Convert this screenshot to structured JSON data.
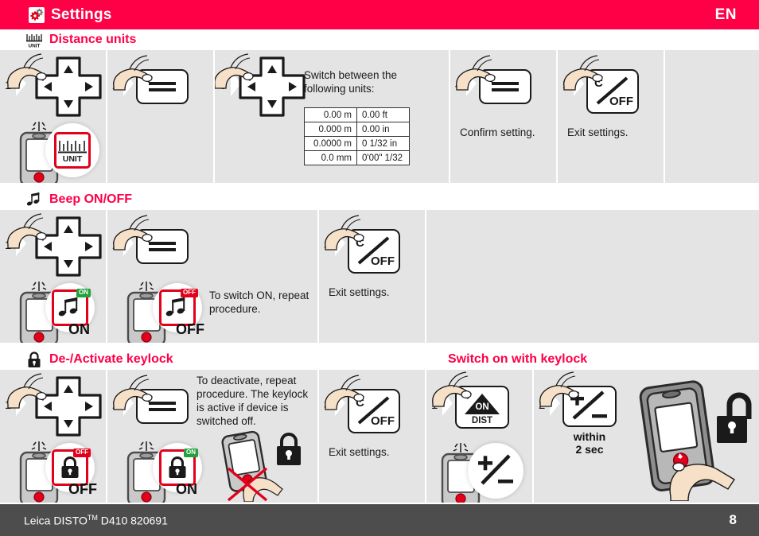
{
  "header": {
    "title": "Settings",
    "icon": "gears-icon",
    "language": "EN",
    "bg_color": "#ff0046"
  },
  "sections": [
    {
      "id": "distance-units",
      "title": "Distance units",
      "icon": "unit-scale-icon",
      "steps": [
        {
          "number": "1",
          "key": "dpad",
          "device_badge": "UNIT",
          "badge_state": ""
        },
        {
          "number": "2",
          "key": "equals",
          "caption": ""
        },
        {
          "number": "3",
          "key": "dpad",
          "caption": "Switch between the following units:",
          "table": [
            [
              "0.00 m",
              "0.00 ft"
            ],
            [
              "0.000 m",
              "0.00 in"
            ],
            [
              "0.0000 m",
              "0 1/32 in"
            ],
            [
              "0.0 mm",
              "0'00\" 1/32"
            ]
          ]
        },
        {
          "number": "4",
          "key": "equals",
          "caption": "Confirm setting."
        },
        {
          "number": "5",
          "key": "c-off",
          "caption": "Exit settings."
        }
      ]
    },
    {
      "id": "beep-on-off",
      "title": "Beep ON/OFF",
      "icon": "music-notes-icon",
      "steps": [
        {
          "number": "1",
          "key": "dpad",
          "badge_state": "ON",
          "state_label": "ON"
        },
        {
          "number": "2",
          "key": "equals",
          "badge_state": "OFF",
          "state_label": "OFF",
          "caption": "To switch ON, repeat procedure."
        },
        {
          "number": "3",
          "key": "c-off",
          "caption": "Exit settings."
        }
      ]
    },
    {
      "id": "de-activate-keylock",
      "title": "De-/Activate keylock",
      "icon": "padlock-icon",
      "steps": [
        {
          "number": "1",
          "key": "dpad",
          "badge_state": "OFF",
          "state_label": "OFF"
        },
        {
          "number": "2",
          "key": "equals",
          "badge_state": "ON",
          "state_label": "ON",
          "caption": "To deactivate, repeat procedure. The keylock is active if device is switched off."
        },
        {
          "number": "3",
          "key": "c-off",
          "caption": "Exit settings."
        }
      ]
    },
    {
      "id": "switch-on-with-keylock",
      "title": "Switch on with keylock",
      "icon": "",
      "steps": [
        {
          "number": "1",
          "key": "on-dist",
          "bubble_symbol": "+/-"
        },
        {
          "number": "2",
          "key": "plus-minus",
          "caption": "within 2 sec"
        }
      ]
    }
  ],
  "labels": {
    "unit_badge": "UNIT",
    "on": "ON",
    "off": "OFF",
    "c": "C",
    "dist": "DIST",
    "within_line1": "within",
    "within_line2": "2 sec"
  },
  "footer": {
    "product": "Leica DISTO",
    "trademark": "TM",
    "model": " D410 820691",
    "page": "8",
    "bg_color": "#4d4d4d"
  },
  "colors": {
    "brand_red": "#ff0046",
    "icon_red": "#e2001a",
    "panel_bg": "#e4e4e4",
    "green": "#22a13c"
  }
}
